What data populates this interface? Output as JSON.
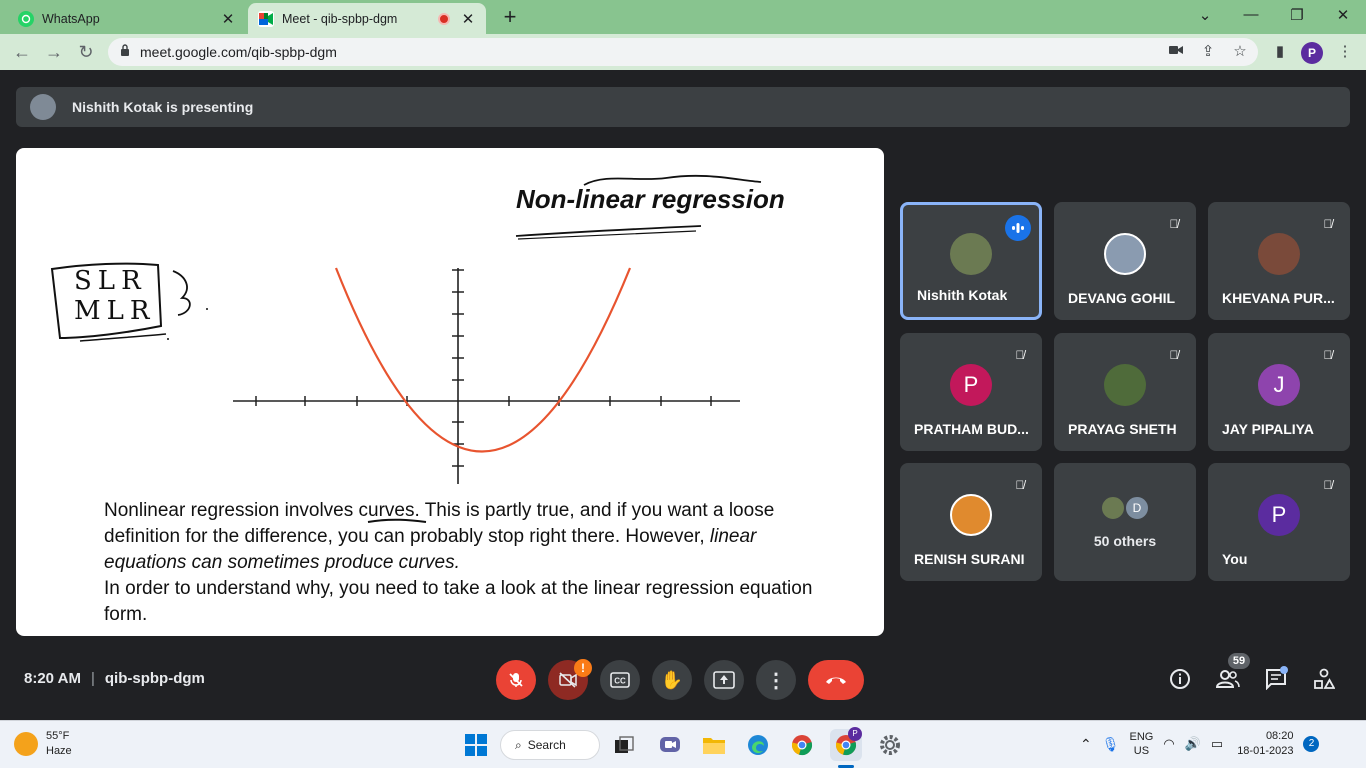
{
  "browser": {
    "tabs": [
      {
        "title": "WhatsApp",
        "active": false
      },
      {
        "title": "Meet - qib-spbp-dgm",
        "active": true
      }
    ],
    "url": "meet.google.com/qib-spbp-dgm",
    "profile_initial": "P"
  },
  "meet": {
    "presenting_text": "Nishith Kotak is presenting",
    "slide": {
      "title": "Non-linear regression",
      "annotation_lines": [
        "SLR",
        "MLR"
      ],
      "paragraph_1_plain": "Nonlinear regression involves ",
      "paragraph_1_underlined": "curves",
      "paragraph_1_rest": ". This is partly true, and if you want a loose definition for the difference, you can probably stop right there. However, ",
      "paragraph_1_italic": "linear equations can sometimes produce curves.",
      "paragraph_2": "In order to understand why, you need to take a look at the linear regression equation form."
    },
    "participants": [
      {
        "name": "Nishith Kotak",
        "speaking": true,
        "avatar_initial": "",
        "avatar_color": "#6b7a52"
      },
      {
        "name": "DEVANG GOHIL",
        "speaking": false,
        "avatar_initial": "",
        "avatar_color": "#8a9bb0"
      },
      {
        "name": "KHEVANA PUR...",
        "speaking": false,
        "avatar_initial": "",
        "avatar_color": "#7a4a3a"
      },
      {
        "name": "PRATHAM BUD...",
        "speaking": false,
        "avatar_initial": "P",
        "avatar_color": "#c2185b"
      },
      {
        "name": "PRAYAG SHETH",
        "speaking": false,
        "avatar_initial": "",
        "avatar_color": "#4f6b3a"
      },
      {
        "name": "JAY PIPALIYA",
        "speaking": false,
        "avatar_initial": "J",
        "avatar_color": "#8e44ad"
      },
      {
        "name": "RENISH SURANI",
        "speaking": false,
        "avatar_initial": "",
        "avatar_color": "#e08a2e"
      },
      {
        "name": "You",
        "speaking": false,
        "avatar_initial": "P",
        "avatar_color": "#5b2c9f"
      }
    ],
    "others": {
      "label": "50 others",
      "avatar_initial": "D"
    },
    "time": "8:20 AM",
    "meeting_code": "qib-spbp-dgm",
    "people_count": "59",
    "camera_alert": "!"
  },
  "taskbar": {
    "weather_temp": "55°F",
    "weather_desc": "Haze",
    "search_label": "Search",
    "lang_primary": "ENG",
    "lang_secondary": "US",
    "clock_time": "08:20",
    "clock_date": "18-01-2023",
    "notification_count": "2"
  },
  "colors": {
    "tab_strip": "#88c48f",
    "end_call": "#ea4335",
    "speaking_blue": "#1a73e8",
    "curve": "#e8542f"
  }
}
